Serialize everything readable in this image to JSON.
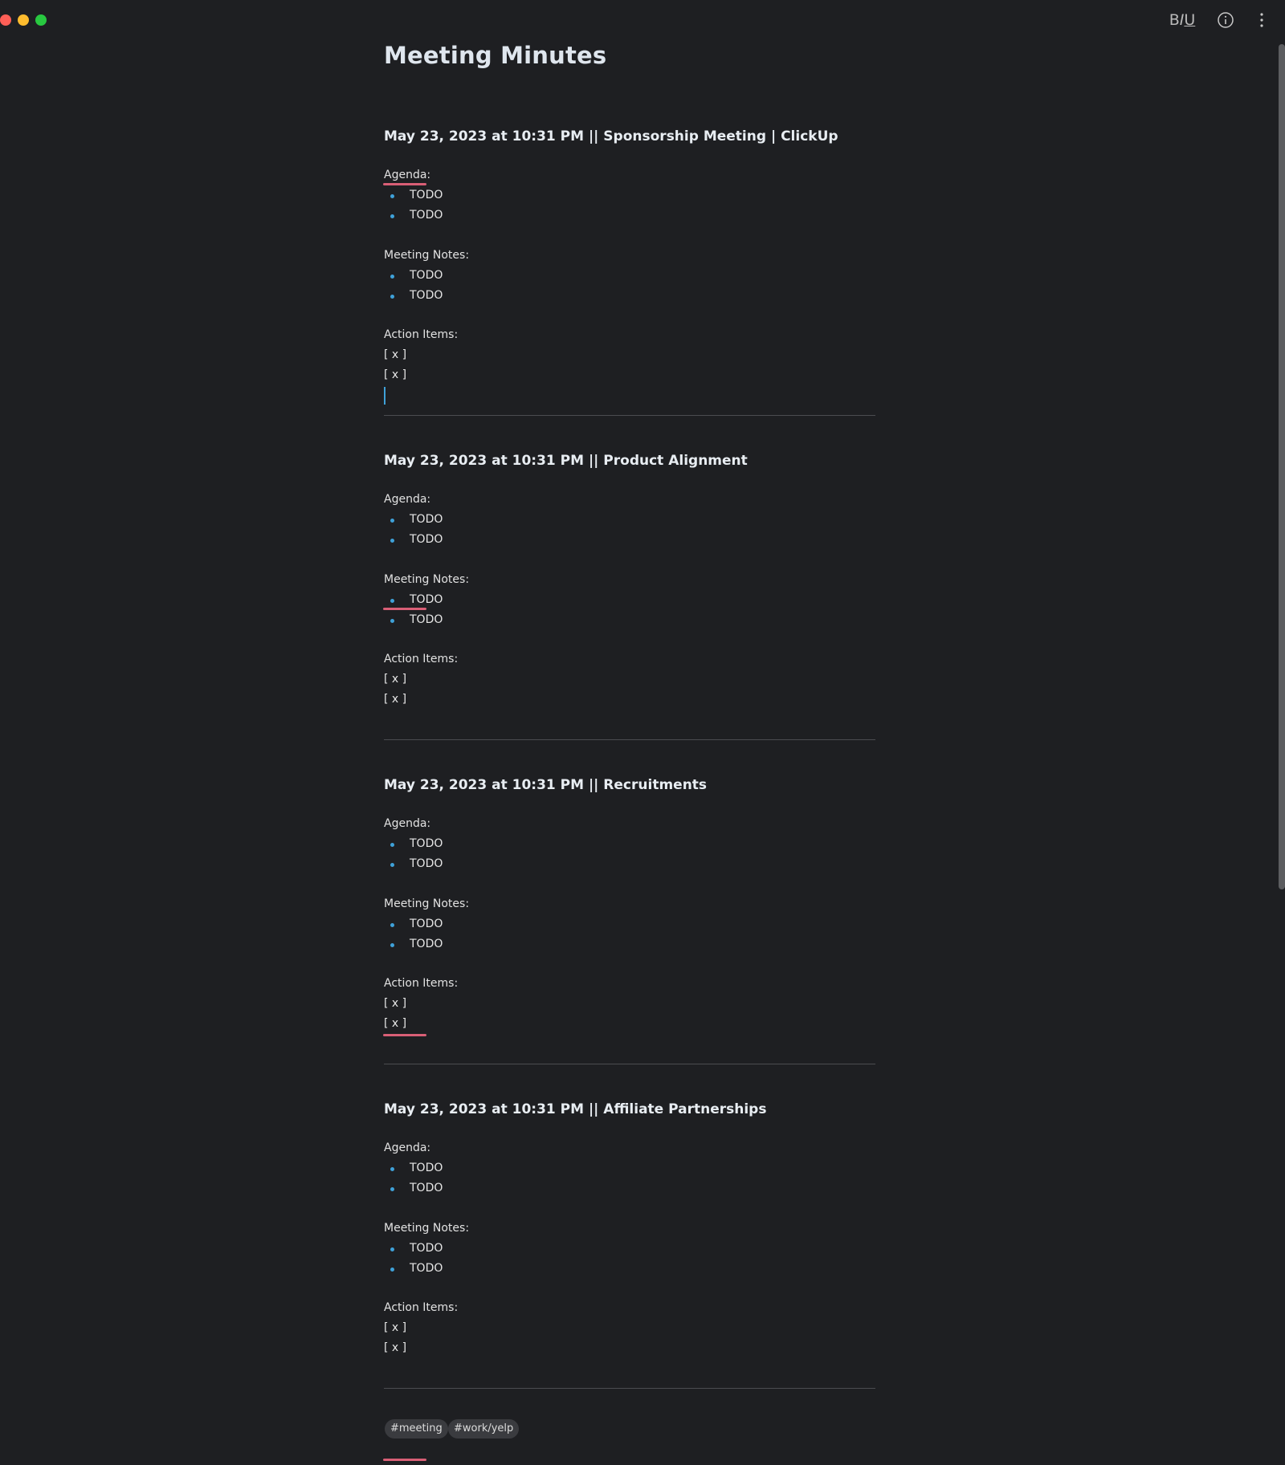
{
  "title": "Meeting Minutes",
  "toolbar": {
    "bold": "B",
    "italic": "I",
    "underline": "U"
  },
  "sections": [
    {
      "heading": "May 23, 2023 at 10:31 PM || Sponsorship Meeting | ClickUp",
      "agenda_label": "Agenda:",
      "agenda": [
        "TODO",
        "TODO"
      ],
      "notes_label": "Meeting Notes:",
      "notes": [
        "TODO",
        "TODO"
      ],
      "actions_label": "Action Items:",
      "actions": [
        "[ x ]",
        "[ x ]"
      ]
    },
    {
      "heading": "May 23, 2023 at 10:31 PM || Product Alignment",
      "agenda_label": "Agenda:",
      "agenda": [
        "TODO",
        "TODO"
      ],
      "notes_label": "Meeting Notes:",
      "notes": [
        "TODO",
        "TODO"
      ],
      "actions_label": "Action Items:",
      "actions": [
        "[ x ]",
        "[ x ]"
      ]
    },
    {
      "heading": "May 23, 2023 at 10:31 PM || Recruitments",
      "agenda_label": "Agenda:",
      "agenda": [
        "TODO",
        "TODO"
      ],
      "notes_label": "Meeting Notes:",
      "notes": [
        "TODO",
        "TODO"
      ],
      "actions_label": "Action Items:",
      "actions": [
        "[ x ]",
        "[ x ]"
      ]
    },
    {
      "heading": "May 23, 2023 at 10:31 PM || Affiliate Partnerships",
      "agenda_label": "Agenda:",
      "agenda": [
        "TODO",
        "TODO"
      ],
      "notes_label": "Meeting Notes:",
      "notes": [
        "TODO",
        "TODO"
      ],
      "actions_label": "Action Items:",
      "actions": [
        "[ x ]",
        "[ x ]"
      ]
    }
  ],
  "tags": [
    "#meeting",
    "#work/yelp"
  ],
  "colors": {
    "background": "#1e1f22",
    "bullet": "#3fa1d8",
    "spellcheck": "#d95f76",
    "tag_bg": "#3a3b3f"
  }
}
